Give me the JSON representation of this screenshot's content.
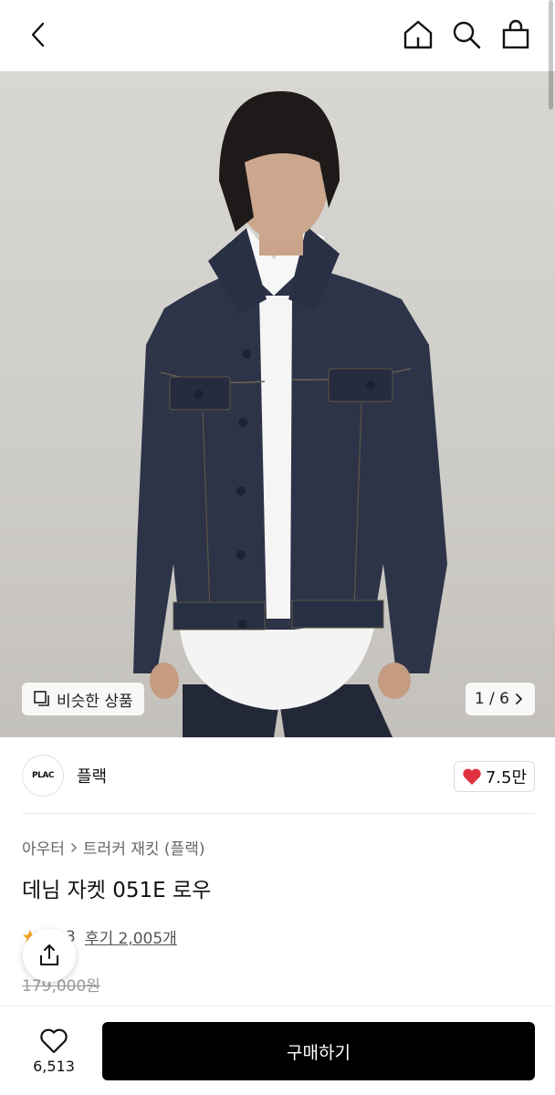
{
  "header": {
    "back_icon": "chevron-left-icon",
    "home_icon": "home-icon",
    "search_icon": "search-icon",
    "bag_icon": "shopping-bag-icon"
  },
  "gallery": {
    "similar_label": "비슷한 상품",
    "similar_icon": "similar-products-icon",
    "page_indicator": "1 / 6"
  },
  "brand": {
    "logo_text": "PLAC",
    "name": "플랙",
    "like_count": "7.5만"
  },
  "product": {
    "breadcrumb": [
      "아우터",
      "트러커 재킷 (플랙)"
    ],
    "title": "데님 자켓 051E 로우",
    "rating_partial": "3",
    "reviews_label": "후기 2,005개",
    "original_price": "179,000원"
  },
  "bottom_bar": {
    "wish_count": "6,513",
    "buy_label": "구매하기"
  },
  "colors": {
    "accent_heart": "#e0313c",
    "buy_button": "#000000",
    "star": "#f5a623"
  }
}
